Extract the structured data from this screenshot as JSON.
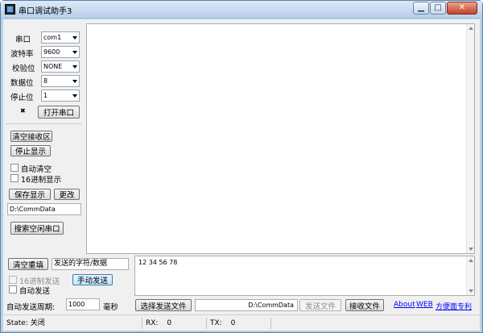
{
  "window": {
    "title": "串口调试助手3",
    "min_glyph": "▁",
    "max_glyph": "□",
    "close_glyph": "✕"
  },
  "serial": {
    "port_label": "串口",
    "port_value": "com1",
    "baud_label": "波特率",
    "baud_value": "9600",
    "parity_label": "校验位",
    "parity_value": "NONE",
    "databits_label": "数据位",
    "databits_value": "8",
    "stopbits_label": "停止位",
    "stopbits_value": "1",
    "open_button": "打开串口",
    "indicator": "✖"
  },
  "receive": {
    "clear_button": "清空接收区",
    "stop_display_button": "停止显示",
    "auto_clear_label": "自动清空",
    "hex_display_label": "16进制显示",
    "save_display_button": "保存显示",
    "change_button": "更改",
    "path_value": "D:\\CommData",
    "search_port_button": "搜索空闲串口",
    "content": ""
  },
  "send": {
    "clear_refill_button": "清空重填",
    "char_label": "发送的字符/数据",
    "hex_send_label": "16进制发送",
    "manual_send_button": "手动发送",
    "auto_send_label": "自动发送",
    "period_label": "自动发送周期:",
    "period_value": "1000",
    "period_unit": "毫秒",
    "content": "12 34 56 78",
    "select_file_button": "选择发送文件",
    "file_path_value": "D:\\CommData",
    "send_file_button": "发送文件",
    "recv_file_button": "接收文件"
  },
  "links": {
    "about": "About",
    "web": "WEB",
    "patent": "方便面专利"
  },
  "status": {
    "state_text": "State: 关闭",
    "rx_label": "RX:",
    "rx_value": "0",
    "tx_label": "TX:",
    "tx_value": "0"
  },
  "colors": {
    "frame": "#b9d1ea",
    "client": "#f0f0f0",
    "link": "#0000ff",
    "close": "#c4412b"
  },
  "icons": [
    "app-icon",
    "minimize-icon",
    "maximize-icon",
    "close-icon",
    "chevron-down-icon",
    "disconnected-icon",
    "scroll-up-icon",
    "scroll-down-icon"
  ]
}
